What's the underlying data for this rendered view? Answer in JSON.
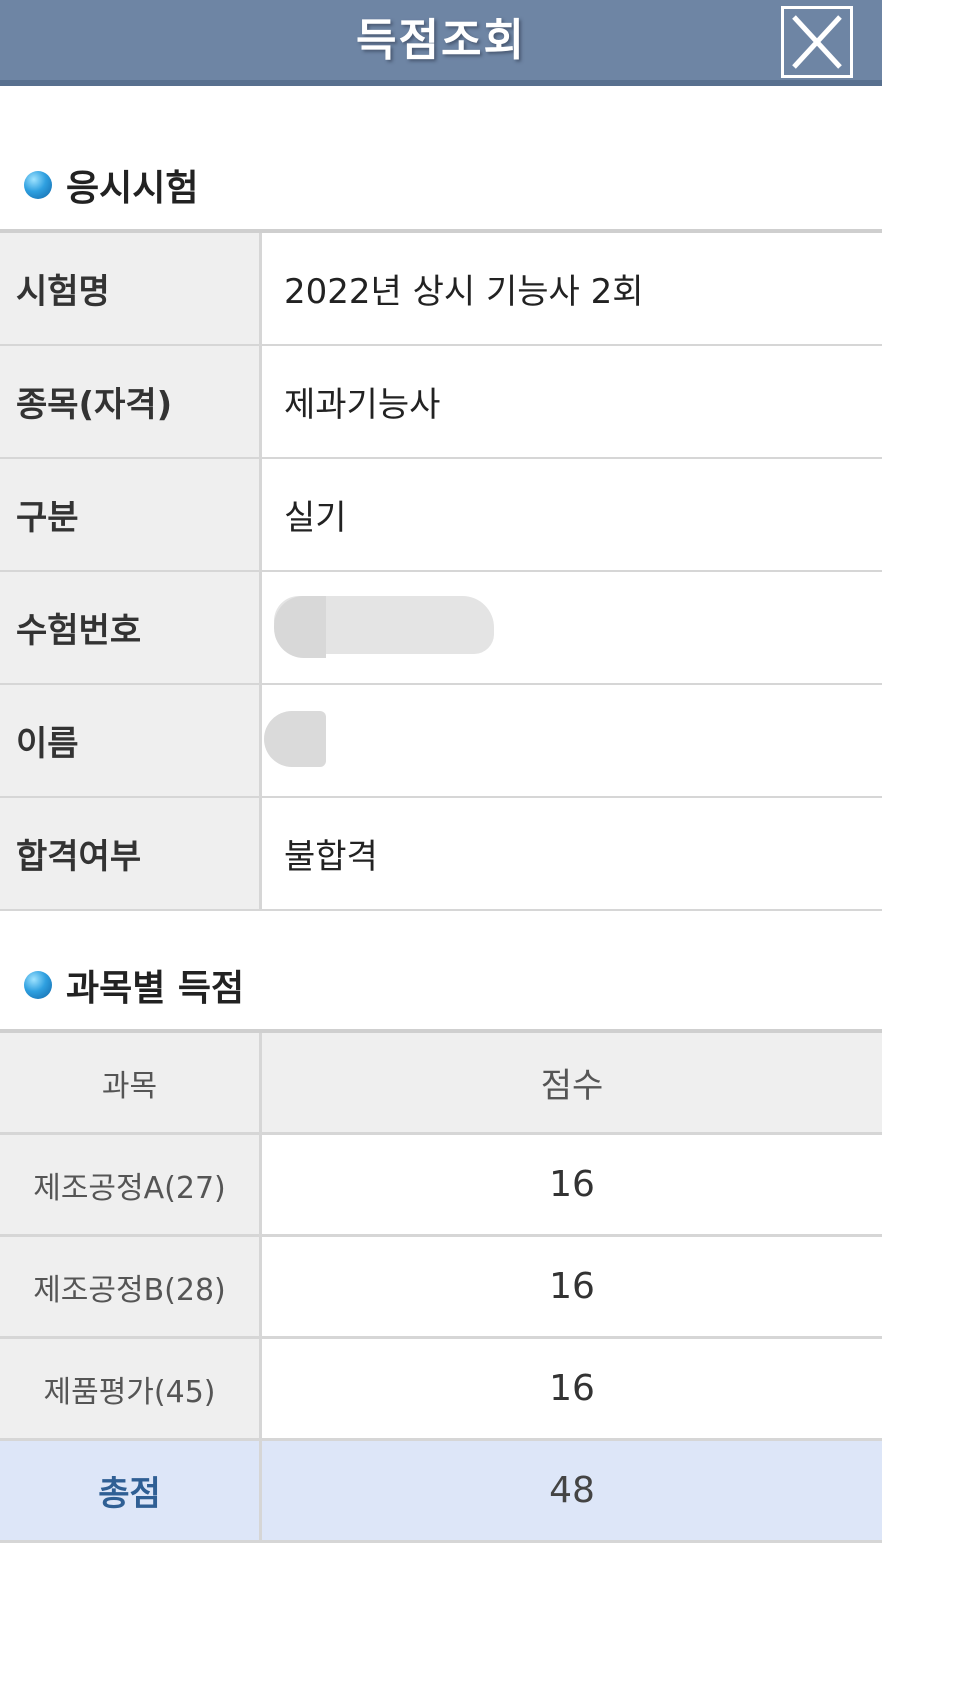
{
  "header": {
    "title": "득점조회",
    "close_icon": "close-icon"
  },
  "exam_section": {
    "heading": "응시시험",
    "rows": [
      {
        "label": "시험명",
        "value": "2022년 상시 기능사 2회"
      },
      {
        "label": "종목(자격)",
        "value": "제과기능사"
      },
      {
        "label": "구분",
        "value": "실기"
      },
      {
        "label": "수험번호",
        "value": ""
      },
      {
        "label": "이름",
        "value": ""
      },
      {
        "label": "합격여부",
        "value": "불합격"
      }
    ]
  },
  "score_section": {
    "heading": "과목별 득점",
    "columns": {
      "subject": "과목",
      "score": "점수"
    },
    "rows": [
      {
        "subject": "제조공정A(27)",
        "score": "16"
      },
      {
        "subject": "제조공정B(28)",
        "score": "16"
      },
      {
        "subject": "제품평가(45)",
        "score": "16"
      }
    ],
    "total": {
      "label": "총점",
      "score": "48"
    }
  },
  "colors": {
    "header_bg": "#6e85a4",
    "label_bg": "#efefef",
    "total_row_bg": "#dde6f8",
    "total_label_color": "#2f5f94",
    "bullet": "#2fa0e0"
  }
}
